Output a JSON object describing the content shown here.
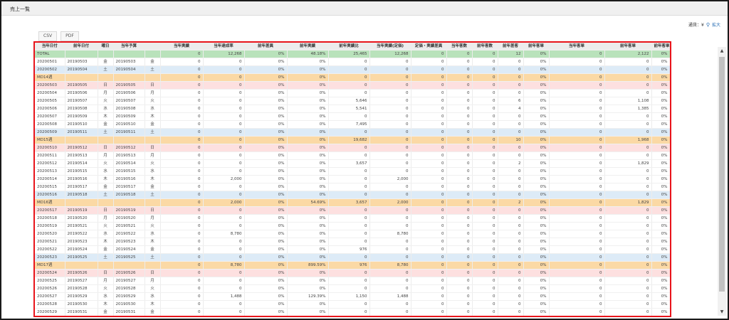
{
  "page": {
    "title": "売上一覧"
  },
  "toolbar": {
    "currency_label": "通貨：¥",
    "zoom_label": "拡大"
  },
  "export": {
    "csv": "CSV",
    "pdf": "PDF"
  },
  "table": {
    "headers": [
      "当年日付",
      "前年日付",
      "曜日",
      "当年予算",
      "",
      "当年実績",
      "当年達成率",
      "前年差異",
      "前年実績",
      "前年実績比",
      "当年実績(定価)",
      "定価・実績差異",
      "当年客数",
      "前年客数",
      "前年差客",
      "前年客単",
      "当年客単",
      "前年客単",
      "前年客単"
    ],
    "rows": [
      {
        "type": "total",
        "cells": [
          "TOTAL",
          "",
          "",
          "",
          "",
          "0",
          "12,268",
          "0%",
          "48.18%",
          "25,465",
          "12,268",
          "0",
          "0",
          "0",
          "12",
          "0%",
          "0",
          "2,122",
          "0%"
        ]
      },
      {
        "type": "wd",
        "cells": [
          "20200501",
          "20190503",
          "金",
          "20190503",
          "金",
          "0",
          "0",
          "0%",
          "0%",
          "0",
          "0",
          "0",
          "0",
          "0",
          "0",
          "0%",
          "0",
          "0",
          "0%"
        ]
      },
      {
        "type": "sat",
        "cells": [
          "20200502",
          "20190504",
          "土",
          "20190504",
          "土",
          "0",
          "0",
          "0%",
          "0%",
          "0",
          "0",
          "0",
          "0",
          "0",
          "0",
          "0%",
          "0",
          "0",
          "0%"
        ]
      },
      {
        "type": "week",
        "cells": [
          "MD14週",
          "",
          "",
          "",
          "",
          "0",
          "0",
          "0%",
          "0%",
          "0",
          "0",
          "0",
          "0",
          "0",
          "0",
          "0%",
          "0",
          "0",
          "0%"
        ]
      },
      {
        "type": "sun",
        "cells": [
          "20200503",
          "20190505",
          "日",
          "20190505",
          "日",
          "0",
          "0",
          "0%",
          "0%",
          "0",
          "0",
          "0",
          "0",
          "0",
          "0",
          "0%",
          "0",
          "0",
          "0%"
        ]
      },
      {
        "type": "wd",
        "cells": [
          "20200504",
          "20190506",
          "月",
          "20190506",
          "月",
          "0",
          "0",
          "0%",
          "0%",
          "0",
          "0",
          "0",
          "0",
          "0",
          "0",
          "0%",
          "0",
          "0",
          "0%"
        ]
      },
      {
        "type": "wd",
        "cells": [
          "20200505",
          "20190507",
          "火",
          "20190507",
          "火",
          "0",
          "0",
          "0%",
          "0%",
          "5,646",
          "0",
          "0",
          "0",
          "0",
          "6",
          "0%",
          "0",
          "1,108",
          "0%"
        ]
      },
      {
        "type": "wd",
        "cells": [
          "20200506",
          "20190508",
          "水",
          "20190508",
          "水",
          "0",
          "0",
          "0%",
          "0%",
          "5,541",
          "0",
          "0",
          "0",
          "0",
          "4",
          "0%",
          "0",
          "1,385",
          "0%"
        ]
      },
      {
        "type": "wd",
        "cells": [
          "20200507",
          "20190509",
          "木",
          "20190509",
          "木",
          "0",
          "0",
          "0%",
          "0%",
          "0",
          "0",
          "0",
          "0",
          "0",
          "0",
          "0%",
          "0",
          "0",
          "0%"
        ]
      },
      {
        "type": "wd",
        "cells": [
          "20200508",
          "20190510",
          "金",
          "20190510",
          "金",
          "0",
          "0",
          "0%",
          "0%",
          "7,495",
          "0",
          "0",
          "0",
          "0",
          "0",
          "0%",
          "0",
          "0",
          "0%"
        ]
      },
      {
        "type": "sat",
        "cells": [
          "20200509",
          "20190511",
          "土",
          "20190511",
          "土",
          "0",
          "0",
          "0%",
          "0%",
          "0",
          "0",
          "0",
          "0",
          "0",
          "0",
          "0%",
          "0",
          "0",
          "0%"
        ]
      },
      {
        "type": "week",
        "cells": [
          "MD15週",
          "",
          "",
          "",
          "",
          "0",
          "0",
          "0%",
          "0%",
          "19,682",
          "0",
          "0",
          "0",
          "0",
          "10",
          "0%",
          "0",
          "1,968",
          "0%"
        ]
      },
      {
        "type": "sun",
        "cells": [
          "20200510",
          "20190512",
          "日",
          "20190512",
          "日",
          "0",
          "0",
          "0%",
          "0%",
          "0",
          "0",
          "0",
          "0",
          "0",
          "0",
          "0%",
          "0",
          "0",
          "0%"
        ]
      },
      {
        "type": "wd",
        "cells": [
          "20200511",
          "20190513",
          "月",
          "20190513",
          "月",
          "0",
          "0",
          "0%",
          "0%",
          "0",
          "0",
          "0",
          "0",
          "0",
          "0",
          "0%",
          "0",
          "0",
          "0%"
        ]
      },
      {
        "type": "wd",
        "cells": [
          "20200512",
          "20190514",
          "火",
          "20190514",
          "火",
          "0",
          "0",
          "0%",
          "0%",
          "3,657",
          "0",
          "0",
          "0",
          "0",
          "2",
          "0%",
          "0",
          "1,829",
          "0%"
        ]
      },
      {
        "type": "wd",
        "cells": [
          "20200513",
          "20190515",
          "水",
          "20190515",
          "水",
          "0",
          "0",
          "0%",
          "0%",
          "0",
          "0",
          "0",
          "0",
          "0",
          "0",
          "0%",
          "0",
          "0",
          "0%"
        ]
      },
      {
        "type": "wd",
        "cells": [
          "20200514",
          "20190516",
          "木",
          "20190516",
          "木",
          "0",
          "2,000",
          "0%",
          "0%",
          "0",
          "2,000",
          "0",
          "0",
          "0",
          "0",
          "0%",
          "0",
          "0",
          "0%"
        ]
      },
      {
        "type": "wd",
        "cells": [
          "20200515",
          "20190517",
          "金",
          "20190517",
          "金",
          "0",
          "0",
          "0%",
          "0%",
          "0",
          "0",
          "0",
          "0",
          "0",
          "0",
          "0%",
          "0",
          "0",
          "0%"
        ]
      },
      {
        "type": "sat",
        "cells": [
          "20200516",
          "20190518",
          "土",
          "20190518",
          "土",
          "0",
          "0",
          "0%",
          "0%",
          "0",
          "0",
          "0",
          "0",
          "0",
          "0",
          "0%",
          "0",
          "0",
          "0%"
        ]
      },
      {
        "type": "week",
        "cells": [
          "MD16週",
          "",
          "",
          "",
          "",
          "0",
          "2,000",
          "0%",
          "54.69%",
          "3,657",
          "2,000",
          "0",
          "0",
          "0",
          "2",
          "0%",
          "0",
          "1,829",
          "0%"
        ]
      },
      {
        "type": "sun",
        "cells": [
          "20200517",
          "20190519",
          "日",
          "20190519",
          "日",
          "0",
          "0",
          "0%",
          "0%",
          "0",
          "0",
          "0",
          "0",
          "0",
          "0",
          "0%",
          "0",
          "0",
          "0%"
        ]
      },
      {
        "type": "wd",
        "cells": [
          "20200518",
          "20190520",
          "月",
          "20190520",
          "月",
          "0",
          "0",
          "0%",
          "0%",
          "0",
          "0",
          "0",
          "0",
          "0",
          "0",
          "0%",
          "0",
          "0",
          "0%"
        ]
      },
      {
        "type": "wd",
        "cells": [
          "20200519",
          "20190521",
          "火",
          "20190521",
          "火",
          "0",
          "0",
          "0%",
          "0%",
          "0",
          "0",
          "0",
          "0",
          "0",
          "0",
          "0%",
          "0",
          "0",
          "0%"
        ]
      },
      {
        "type": "wd",
        "cells": [
          "20200520",
          "20190522",
          "水",
          "20190522",
          "水",
          "0",
          "8,780",
          "0%",
          "0%",
          "0",
          "8,780",
          "0",
          "0",
          "0",
          "0",
          "0%",
          "0",
          "0",
          "0%"
        ]
      },
      {
        "type": "wd",
        "cells": [
          "20200521",
          "20190523",
          "木",
          "20190523",
          "木",
          "0",
          "0",
          "0%",
          "0%",
          "0",
          "0",
          "0",
          "0",
          "0",
          "0",
          "0%",
          "0",
          "0",
          "0%"
        ]
      },
      {
        "type": "wd",
        "cells": [
          "20200522",
          "20190524",
          "金",
          "20190524",
          "金",
          "0",
          "0",
          "0%",
          "0%",
          "976",
          "0",
          "0",
          "0",
          "0",
          "0",
          "0%",
          "0",
          "0",
          "0%"
        ]
      },
      {
        "type": "sat",
        "cells": [
          "20200523",
          "20190525",
          "土",
          "20190525",
          "土",
          "0",
          "0",
          "0%",
          "0%",
          "0",
          "0",
          "0",
          "0",
          "0",
          "0",
          "0%",
          "0",
          "0",
          "0%"
        ]
      },
      {
        "type": "week",
        "cells": [
          "MD17週",
          "",
          "",
          "",
          "",
          "0",
          "8,780",
          "0%",
          "899.59%",
          "976",
          "8,780",
          "0",
          "0",
          "0",
          "0",
          "0%",
          "0",
          "0",
          "0%"
        ]
      },
      {
        "type": "sun",
        "cells": [
          "20200524",
          "20190526",
          "日",
          "20190526",
          "日",
          "0",
          "0",
          "0%",
          "0%",
          "0",
          "0",
          "0",
          "0",
          "0",
          "0",
          "0%",
          "0",
          "0",
          "0%"
        ]
      },
      {
        "type": "wd",
        "cells": [
          "20200525",
          "20190527",
          "月",
          "20190527",
          "月",
          "0",
          "0",
          "0%",
          "0%",
          "0",
          "0",
          "0",
          "0",
          "0",
          "0",
          "0%",
          "0",
          "0",
          "0%"
        ]
      },
      {
        "type": "wd",
        "cells": [
          "20200526",
          "20190528",
          "火",
          "20190528",
          "火",
          "0",
          "0",
          "0%",
          "0%",
          "0",
          "0",
          "0",
          "0",
          "0",
          "0",
          "0%",
          "0",
          "0",
          "0%"
        ]
      },
      {
        "type": "wd",
        "cells": [
          "20200527",
          "20190529",
          "水",
          "20190529",
          "水",
          "0",
          "1,488",
          "0%",
          "129.39%",
          "1,150",
          "1,488",
          "0",
          "0",
          "0",
          "0",
          "0%",
          "0",
          "0",
          "0%"
        ]
      },
      {
        "type": "wd",
        "cells": [
          "20200528",
          "20190530",
          "木",
          "20190530",
          "木",
          "0",
          "0",
          "0%",
          "0%",
          "0",
          "0",
          "0",
          "0",
          "0",
          "0",
          "0%",
          "0",
          "0",
          "0%"
        ]
      },
      {
        "type": "wd",
        "cells": [
          "20200529",
          "20190531",
          "金",
          "20190531",
          "金",
          "0",
          "0",
          "0%",
          "0%",
          "0",
          "0",
          "0",
          "0",
          "0",
          "0",
          "0%",
          "0",
          "0",
          "0%"
        ]
      },
      {
        "type": "sat",
        "cells": [
          "20200530",
          "20190601",
          "土",
          "20190601",
          "土",
          "0",
          "0",
          "0%",
          "0%",
          "0",
          "0",
          "0",
          "0",
          "0",
          "0",
          "0%",
          "0",
          "0",
          "0%"
        ]
      }
    ]
  }
}
